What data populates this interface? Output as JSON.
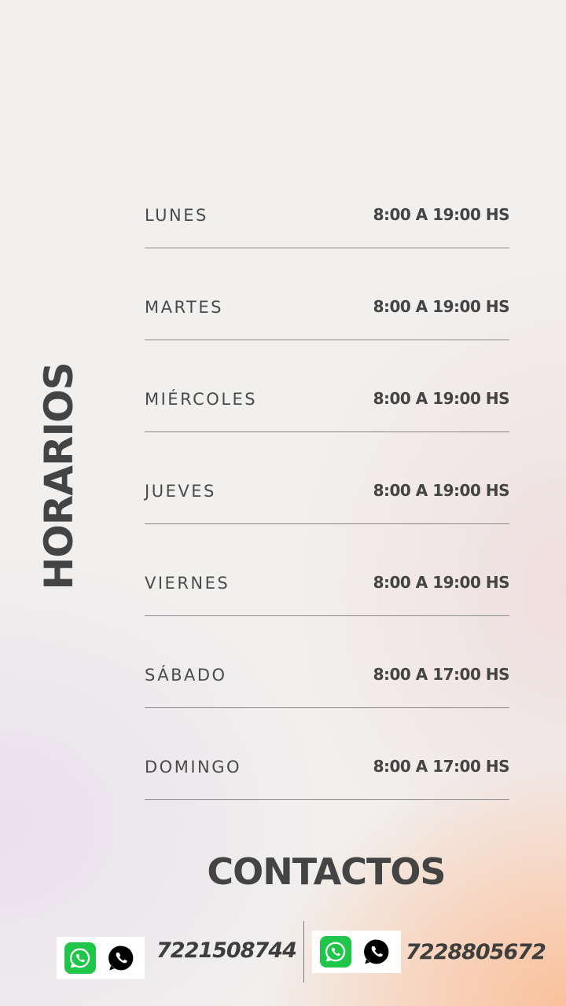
{
  "title": "HORARIOS",
  "schedule": [
    {
      "day": "LUNES",
      "hours": "8:00 A 19:00 HS"
    },
    {
      "day": "MARTES",
      "hours": "8:00 A 19:00 HS"
    },
    {
      "day": "MIÉRCOLES",
      "hours": "8:00 A 19:00 HS"
    },
    {
      "day": "JUEVES",
      "hours": "8:00 A 19:00 HS"
    },
    {
      "day": "VIERNES",
      "hours": "8:00 A 19:00 HS"
    },
    {
      "day": "SÁBADO",
      "hours": "8:00 A 17:00 HS"
    },
    {
      "day": "DOMINGO",
      "hours": "8:00 A 17:00 HS"
    }
  ],
  "contacts": {
    "title": "CONTACTOS",
    "phones": [
      "7221508744",
      "7228805672"
    ],
    "icons": [
      "whatsapp-logo-icon",
      "whatsapp-bubble-icon"
    ],
    "colors": {
      "whatsapp_green": "#1fc64a",
      "text": "#444444"
    }
  }
}
